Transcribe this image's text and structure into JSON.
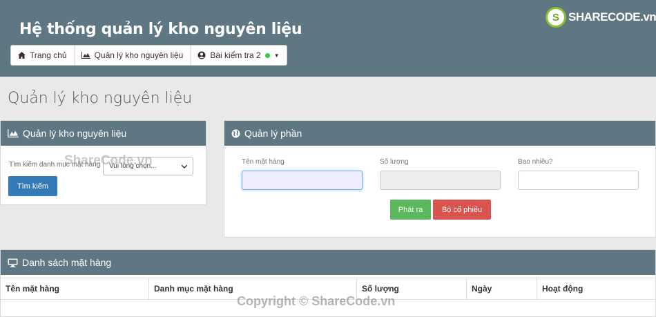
{
  "header": {
    "title": "Hệ thống quản lý kho nguyên liệu",
    "logo_badge": "S",
    "logo_text": "SHARECODE.vn"
  },
  "nav": {
    "items": [
      {
        "label": "Trang chủ",
        "icon": "home-icon"
      },
      {
        "label": "Quản lý kho nguyên liệu",
        "icon": "area-chart-icon"
      },
      {
        "label": "Bài kiểm tra 2",
        "icon": "user-circle-icon"
      }
    ]
  },
  "page": {
    "title": "Quản lý kho nguyên liệu"
  },
  "search_panel": {
    "title": "Quản lý kho nguyên liệu",
    "search_label": "Tìm kiếm danh mục mặt hàng",
    "select_value": "Vui lòng chọn...",
    "search_button": "Tìm kiếm"
  },
  "manage_panel": {
    "title": "Quản lý phần",
    "fields": [
      {
        "label": "Tên mặt hàng",
        "value": ""
      },
      {
        "label": "Số lượng",
        "value": ""
      },
      {
        "label": "Bao nhiêu?",
        "value": ""
      }
    ],
    "issue_button": "Phát ra",
    "remove_button": "Bộ cổ phiếu"
  },
  "list_panel": {
    "title": "Danh sách mặt hàng",
    "columns": [
      "Tên mặt hàng",
      "Danh mục mặt hàng",
      "Số lượng",
      "Ngày",
      "Hoạt động"
    ]
  },
  "watermarks": {
    "inline": "ShareCode.vn",
    "footer": "Copyright © ShareCode.vn"
  },
  "colors": {
    "header": "#5f7683",
    "primary": "#337ab7",
    "success": "#5cb85c",
    "danger": "#d9534f",
    "status_dot": "#2ecc40"
  }
}
